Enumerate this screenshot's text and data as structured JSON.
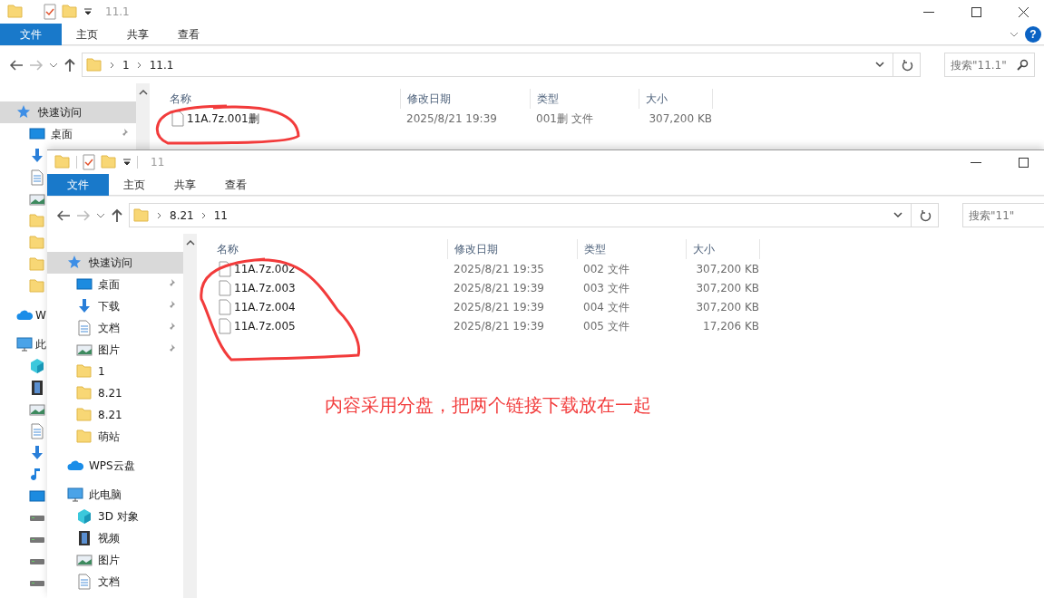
{
  "windows": [
    {
      "title": "11.1",
      "help_button": "?",
      "ribbon_tabs": [
        {
          "label": "文件",
          "selected": true
        },
        {
          "label": "主页",
          "selected": false
        },
        {
          "label": "共享",
          "selected": false
        },
        {
          "label": "查看",
          "selected": false
        }
      ],
      "path": [
        "1",
        "11.1"
      ],
      "search": {
        "placeholder": "搜索\"11.1\""
      },
      "nav": [
        {
          "label": "快速访问",
          "kind": "star",
          "selected": true,
          "children": [
            {
              "label": "桌面",
              "kind": "desktop",
              "pinned": true,
              "selected": false
            },
            {
              "kind": "download",
              "selected": false
            },
            {
              "kind": "doc",
              "selected": false
            },
            {
              "kind": "picture",
              "selected": false
            },
            {
              "kind": "folder",
              "selected": false
            },
            {
              "kind": "folder",
              "selected": false
            },
            {
              "kind": "folder",
              "selected": false
            },
            {
              "kind": "folder",
              "selected": false
            }
          ]
        },
        {
          "label": "W",
          "kind": "cloud",
          "selected": false
        },
        {
          "label": "此",
          "kind": "pc",
          "selected": false,
          "children": [
            {
              "kind": "cube",
              "selected": false
            },
            {
              "kind": "video",
              "selected": false
            },
            {
              "kind": "picture",
              "selected": false
            },
            {
              "kind": "doc",
              "selected": false
            },
            {
              "kind": "download",
              "selected": false
            },
            {
              "kind": "music",
              "selected": false
            },
            {
              "kind": "desktop",
              "selected": false
            },
            {
              "kind": "drive",
              "selected": false
            },
            {
              "kind": "drive",
              "selected": false
            },
            {
              "kind": "drive",
              "selected": false
            },
            {
              "kind": "drive",
              "selected": false
            }
          ]
        }
      ],
      "columns": [
        "名称",
        "修改日期",
        "类型",
        "大小"
      ],
      "files": [
        {
          "name": "11A.7z.001删",
          "modified": "2025/8/21 19:39",
          "type": "001删 文件",
          "size": "307,200 KB"
        }
      ]
    },
    {
      "title": "11",
      "ribbon_tabs": [
        {
          "label": "文件",
          "selected": true
        },
        {
          "label": "主页",
          "selected": false
        },
        {
          "label": "共享",
          "selected": false
        },
        {
          "label": "查看",
          "selected": false
        }
      ],
      "path": [
        "8.21",
        "11"
      ],
      "search": {
        "placeholder": "搜索\"11\""
      },
      "nav": [
        {
          "label": "快速访问",
          "kind": "star",
          "selected": true,
          "children": [
            {
              "label": "桌面",
              "kind": "desktop",
              "pinned": true,
              "selected": false
            },
            {
              "label": "下载",
              "kind": "download",
              "pinned": true,
              "selected": false
            },
            {
              "label": "文档",
              "kind": "doc",
              "pinned": true,
              "selected": false
            },
            {
              "label": "图片",
              "kind": "picture",
              "pinned": true,
              "selected": false
            },
            {
              "label": "1",
              "kind": "folder",
              "selected": false
            },
            {
              "label": "8.21",
              "kind": "folder",
              "selected": false
            },
            {
              "label": "8.21",
              "kind": "folder",
              "selected": false
            },
            {
              "label": "萌站",
              "kind": "folder",
              "selected": false
            }
          ]
        },
        {
          "label": "WPS云盘",
          "kind": "cloud",
          "selected": false
        },
        {
          "label": "此电脑",
          "kind": "pc",
          "selected": false,
          "children": [
            {
              "label": "3D 对象",
              "kind": "cube",
              "selected": false
            },
            {
              "label": "视频",
              "kind": "video",
              "selected": false
            },
            {
              "label": "图片",
              "kind": "picture",
              "selected": false
            },
            {
              "label": "文档",
              "kind": "doc",
              "selected": false
            }
          ]
        }
      ],
      "columns": [
        "名称",
        "修改日期",
        "类型",
        "大小"
      ],
      "files": [
        {
          "name": "11A.7z.002",
          "modified": "2025/8/21 19:35",
          "type": "002 文件",
          "size": "307,200 KB"
        },
        {
          "name": "11A.7z.003",
          "modified": "2025/8/21 19:39",
          "type": "003 文件",
          "size": "307,200 KB"
        },
        {
          "name": "11A.7z.004",
          "modified": "2025/8/21 19:39",
          "type": "004 文件",
          "size": "307,200 KB"
        },
        {
          "name": "11A.7z.005",
          "modified": "2025/8/21 19:39",
          "type": "005 文件",
          "size": "17,206 KB"
        }
      ]
    }
  ],
  "annotation": {
    "text": "内容采用分盘，把两个链接下载放在一起"
  }
}
